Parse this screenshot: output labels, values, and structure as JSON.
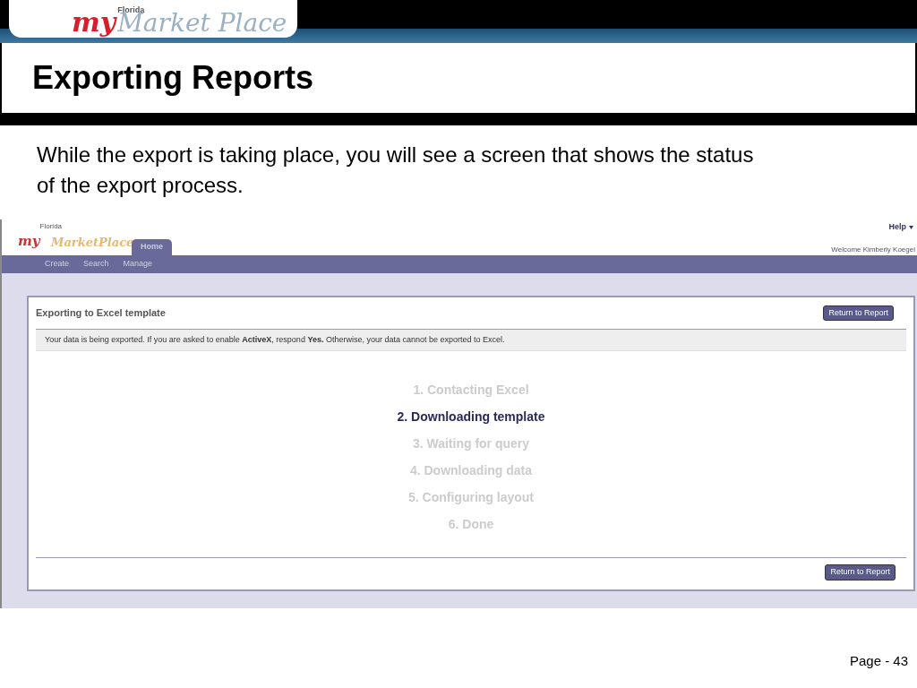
{
  "slide_header": {
    "logo": {
      "prefix": "my",
      "state": "Florida",
      "name": "Market Place"
    }
  },
  "title": "Exporting Reports",
  "body": "While the export is taking place, you will see a screen that shows the status of the export process.",
  "screenshot": {
    "logo": {
      "prefix": "my",
      "state": "Florida",
      "name": "MarketPlace"
    },
    "tabs": [
      {
        "label": "Home",
        "selected": true
      }
    ],
    "help": "Help",
    "welcome": "Welcome Kimberly Koegel",
    "nav": [
      "Create",
      "Search",
      "Manage"
    ],
    "panel": {
      "heading": "Exporting to Excel template",
      "button_top": "Return to Report",
      "message": "Your data is being exported. If you are asked to enable **ActiveX**, respond **Yes.** Otherwise, your data cannot be exported to Excel.",
      "steps": [
        {
          "label": "1. Contacting Excel",
          "selected": false
        },
        {
          "label": "2. Downloading template",
          "selected": true
        },
        {
          "label": "3. Waiting for query",
          "selected": false
        },
        {
          "label": "4. Downloading data",
          "selected": false
        },
        {
          "label": "5. Configuring layout",
          "selected": false
        },
        {
          "label": "6. Done",
          "selected": false
        }
      ],
      "button_bottom": "Return to Report"
    }
  },
  "footer": {
    "page": "Page - 43"
  }
}
